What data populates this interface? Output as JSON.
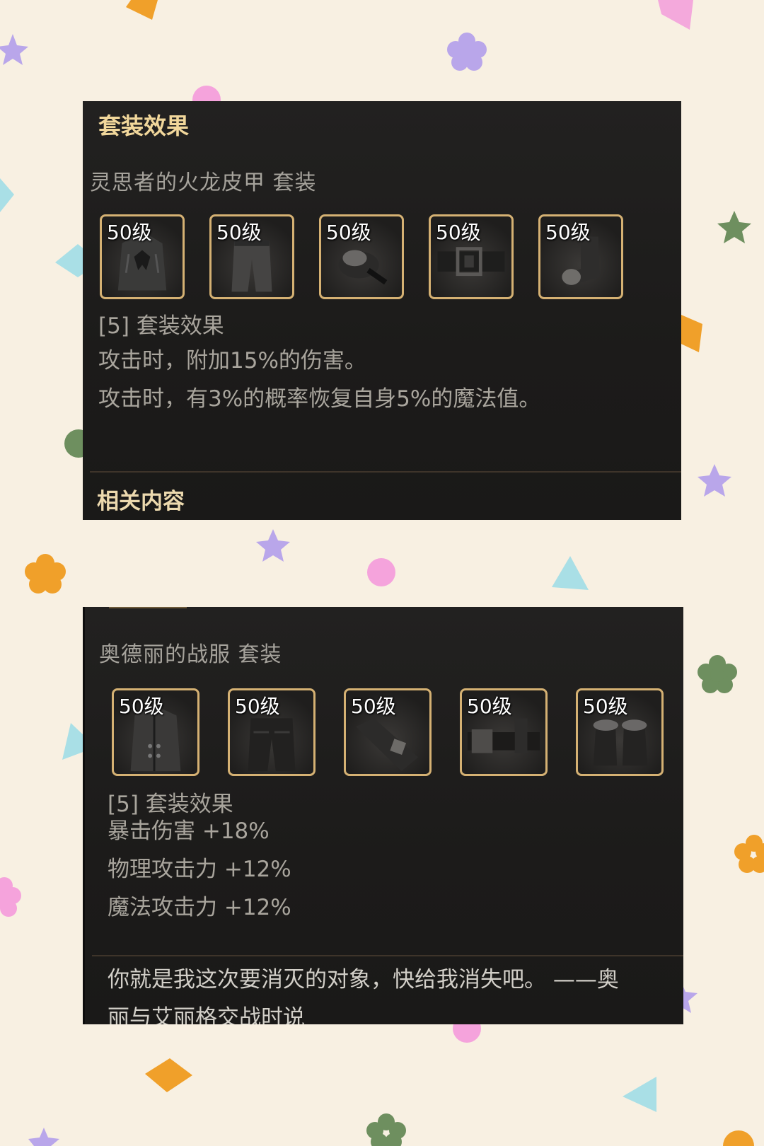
{
  "panel1": {
    "header": "套装效果",
    "set_name": "灵思者的火龙皮甲  套装",
    "items": [
      {
        "level": "50级",
        "icon": "armor-jacket-icon"
      },
      {
        "level": "50级",
        "icon": "pants-icon"
      },
      {
        "level": "50级",
        "icon": "shoulder-pad-icon"
      },
      {
        "level": "50级",
        "icon": "belt-icon"
      },
      {
        "level": "50级",
        "icon": "boots-icon"
      }
    ],
    "bonus_title": "[5] 套装效果",
    "effects": [
      "攻击时，附加15%的伤害。",
      "攻击时，有3%的概率恢复自身5%的魔法值。"
    ],
    "related": "相关内容"
  },
  "panel2": {
    "set_name": "奥德丽的战服  套装",
    "items": [
      {
        "level": "50级",
        "icon": "coat-icon"
      },
      {
        "level": "50级",
        "icon": "pants-icon"
      },
      {
        "level": "50级",
        "icon": "shoulder-pad-icon"
      },
      {
        "level": "50级",
        "icon": "belt-icon"
      },
      {
        "level": "50级",
        "icon": "fur-boots-icon"
      }
    ],
    "bonus_title": "[5] 套装效果",
    "effects": [
      "暴击伤害 +18%",
      "物理攻击力 +12%",
      "魔法攻击力 +12%"
    ],
    "quote_line1": "你就是我这次要消灭的对象，快给我消失吧。 ——奥",
    "quote_line2": "丽与艾丽格交战时说"
  },
  "colors": {
    "page_bg": "#f8f0e2",
    "panel_bg": "#1d1c1b",
    "header_gold": "#f1d79b",
    "item_border": "#d5b173",
    "text_gray": "#a9a59d"
  }
}
